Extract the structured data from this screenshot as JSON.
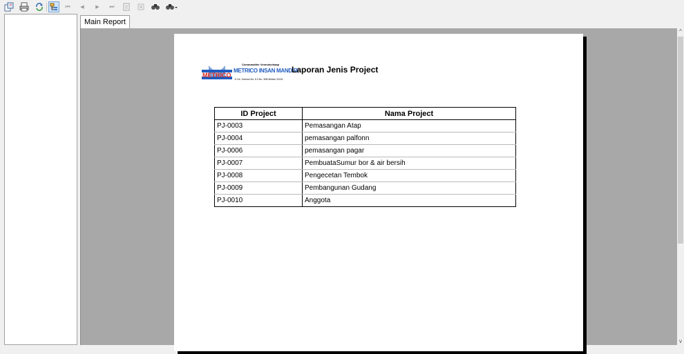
{
  "toolbar": {
    "items": [
      {
        "name": "export-icon"
      },
      {
        "name": "print-icon"
      },
      {
        "name": "refresh-icon"
      },
      {
        "name": "toggle-tree-icon"
      },
      {
        "name": "first-page-icon",
        "glyph": "⏮"
      },
      {
        "name": "prev-page-icon",
        "glyph": "◀"
      },
      {
        "name": "next-page-icon",
        "glyph": "▶"
      },
      {
        "name": "last-page-icon",
        "glyph": "⏭"
      },
      {
        "name": "goto-page-icon"
      },
      {
        "name": "stop-icon"
      },
      {
        "name": "search-icon"
      },
      {
        "name": "zoom-icon"
      }
    ]
  },
  "tabs": [
    {
      "label": "Main Report"
    }
  ],
  "report": {
    "company_header": "Commanditer Vennotschaap",
    "company_name": "METRICO INSAN MANDIRI",
    "company_address": "Jl. Ks. Sutomo No. 6.3 No. 30B Medan 20241",
    "logo_text": "METRICO",
    "title": "Laporan Jenis Project",
    "columns": [
      "ID Project",
      "Nama Project"
    ],
    "rows": [
      [
        "PJ-0003",
        "Pemasangan Atap"
      ],
      [
        "PJ-0004",
        "pemasangan palfonn"
      ],
      [
        "PJ-0006",
        "pemasangan pagar"
      ],
      [
        "PJ-0007",
        "PembuataSumur bor & air bersih"
      ],
      [
        "PJ-0008",
        "Pengecetan Tembok"
      ],
      [
        "PJ-0009",
        "Pembangunan Gudang"
      ],
      [
        "PJ-0010",
        "Anggota"
      ]
    ]
  },
  "colors": {
    "viewer_bg": "#a8a8a8",
    "logo_blue": "#1e5bbf",
    "logo_red": "#d8261c"
  }
}
